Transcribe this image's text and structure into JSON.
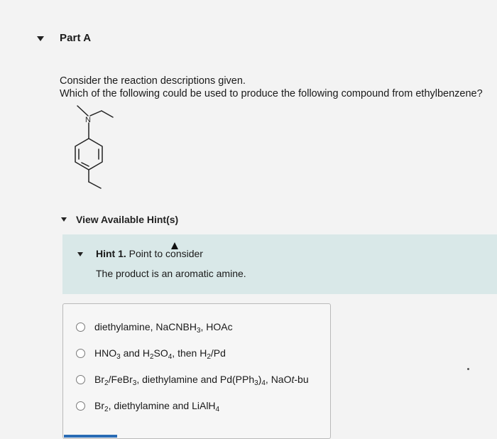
{
  "part": {
    "title": "Part A"
  },
  "question": {
    "line1": "Consider the reaction descriptions given.",
    "line2": "Which of the following could be used to produce the following compound from ethylbenzene?",
    "structure_atom_label": "N"
  },
  "hints": {
    "toggle_label": "View Available Hint(s)",
    "hint1": {
      "number": "Hint 1.",
      "title": "Point to consider",
      "body": "The product is an aromatic amine."
    }
  },
  "options": [
    {
      "label": "diethylamine, NaCNBH3, HOAc"
    },
    {
      "label": "HNO3 and H2SO4, then H2/Pd"
    },
    {
      "label": "Br2/FeBr3, diethylamine and Pd(PPh3)4, NaOt-bu"
    },
    {
      "label": "Br2, diethylamine and LiAlH4"
    }
  ],
  "colors": {
    "hint_bg": "#d9e8e8",
    "accent": "#2a6cb5"
  }
}
